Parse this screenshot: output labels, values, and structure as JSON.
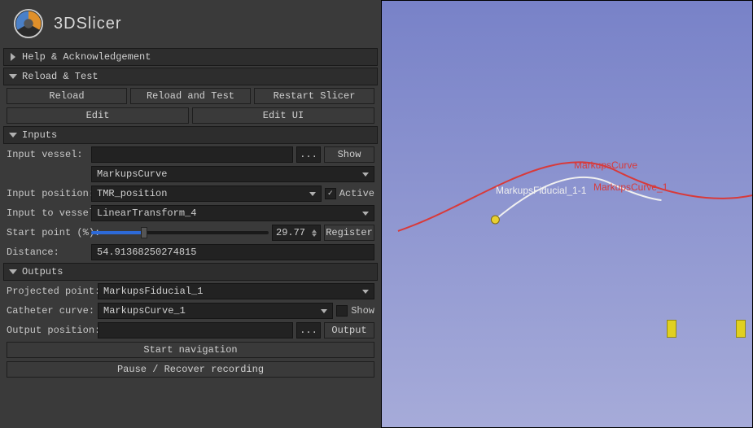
{
  "header": {
    "app_title": "3DSlicer"
  },
  "sections": {
    "help": {
      "title": "Help & Acknowledgement"
    },
    "reload": {
      "title": "Reload & Test",
      "reload_btn": "Reload",
      "reload_test_btn": "Reload and Test",
      "restart_btn": "Restart Slicer",
      "edit_btn": "Edit",
      "edit_ui_btn": "Edit UI"
    },
    "inputs": {
      "title": "Inputs",
      "vessel_label": "Input vessel:",
      "vessel_select": "",
      "vessel_browse": "...",
      "show_btn": "Show",
      "vessel_curve": "MarkupsCurve",
      "position_label": "Input position:",
      "position_select": "TMR_position",
      "active_chk": "✓",
      "active_label": "Active",
      "tovessel_label": "Input to vessel:",
      "tovessel_select": "LinearTransform_4",
      "startpoint_label": "Start point (%):",
      "startpoint_value": "29.77",
      "register_btn": "Register",
      "distance_label": "Distance:",
      "distance_value": "54.91368250274815"
    },
    "outputs": {
      "title": "Outputs",
      "projpoint_label": "Projected point:",
      "projpoint_select": "MarkupsFiducial_1",
      "cathcurve_label": "Catheter curve:",
      "cathcurve_select": "MarkupsCurve_1",
      "show_label": "Show",
      "outpos_label": "Output position:",
      "outpos_value": "",
      "outpos_browse": "...",
      "output_btn": "Output",
      "startnav_btn": "Start navigation",
      "pauserec_btn": "Pause / Recover recording"
    }
  },
  "viewport": {
    "labels": {
      "markups_curve": "MarkupsCurve",
      "markups_curve_1": "MarkupsCurve_1",
      "markups_fiducial_1_1": "MarkupsFiducial_1-1"
    },
    "curve_colors": {
      "outer": "#d83a3a",
      "inner": "#f0f0f0"
    }
  }
}
